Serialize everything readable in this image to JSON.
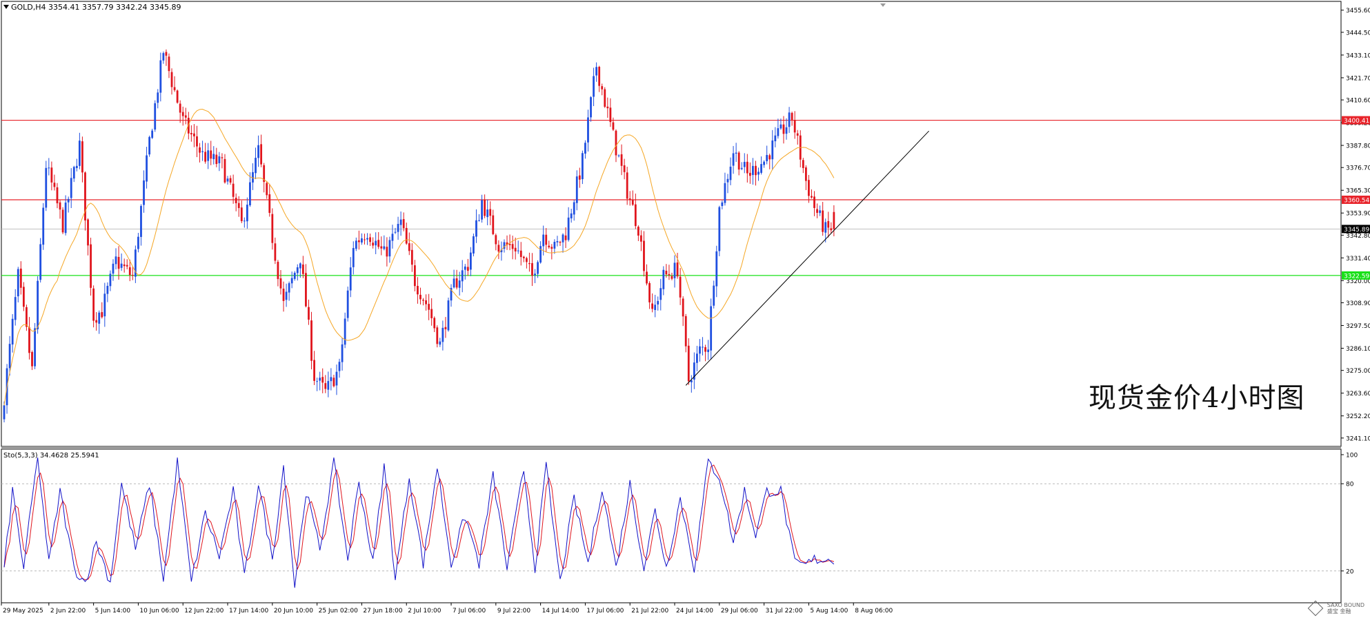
{
  "header": {
    "symbol_line": "GOLD,H4  3354.41 3357.79 3342.24 3345.89"
  },
  "annotation": {
    "text": "现货金价4小时图"
  },
  "watermark": {
    "line1": "SAXO BOUND",
    "line2": "盛宝 金融"
  },
  "colors": {
    "bull": "#1f4fe0",
    "bear": "#e0141c",
    "ma": "#f5a623",
    "resistance": "#e8242b",
    "support": "#19e019",
    "trendline": "#000000",
    "stoch_k": "#1010c8",
    "stoch_d": "#e0141c",
    "grid": "#b8b8b8"
  },
  "chart_data": [
    {
      "type": "candlestick",
      "symbol": "GOLD",
      "timeframe": "H4",
      "last_bar": {
        "open": 3354.41,
        "high": 3357.79,
        "low": 3342.24,
        "close": 3345.89
      },
      "ylim": [
        3236.9,
        3460.0
      ],
      "y_ticks": [
        3455.6,
        3444.5,
        3433.1,
        3421.7,
        3410.6,
        3399.2,
        3387.8,
        3376.7,
        3365.3,
        3353.9,
        3342.8,
        3331.4,
        3320.0,
        3308.9,
        3297.5,
        3286.1,
        3275.0,
        3263.6,
        3252.2,
        3241.1
      ],
      "x_tick_labels": [
        "29 May 2025",
        "2 Jun 22:00",
        "5 Jun 14:00",
        "10 Jun 06:00",
        "12 Jun 22:00",
        "17 Jun 14:00",
        "20 Jun 10:00",
        "25 Jun 02:00",
        "27 Jun 18:00",
        "2 Jul 10:00",
        "7 Jul 06:00",
        "9 Jul 22:00",
        "14 Jul 14:00",
        "17 Jul 06:00",
        "21 Jul 22:00",
        "24 Jul 14:00",
        "29 Jul 06:00",
        "31 Jul 22:00",
        "5 Aug 14:00",
        "8 Aug 06:00"
      ],
      "horizontal_levels": [
        {
          "label": "3400.41",
          "value": 3400.41,
          "kind": "resistance"
        },
        {
          "label": "3360.54",
          "value": 3360.54,
          "kind": "resistance"
        },
        {
          "label": "3345.89",
          "value": 3345.89,
          "kind": "current"
        },
        {
          "label": "3322.59",
          "value": 3322.59,
          "kind": "support"
        }
      ],
      "trendline": {
        "from_bar": 244,
        "from_price": 3267.5,
        "to_bar": 331,
        "to_price": 3395.0
      },
      "price_path": [
        [
          0,
          3250
        ],
        [
          6,
          3322
        ],
        [
          11,
          3275
        ],
        [
          16,
          3378
        ],
        [
          22,
          3348
        ],
        [
          28,
          3388
        ],
        [
          33,
          3302
        ],
        [
          36,
          3305
        ],
        [
          41,
          3330
        ],
        [
          47,
          3322
        ],
        [
          53,
          3390
        ],
        [
          58,
          3435
        ],
        [
          65,
          3400
        ],
        [
          72,
          3383
        ],
        [
          79,
          3378
        ],
        [
          86,
          3348
        ],
        [
          92,
          3385
        ],
        [
          96,
          3350
        ],
        [
          101,
          3308
        ],
        [
          107,
          3332
        ],
        [
          112,
          3272
        ],
        [
          116,
          3264
        ],
        [
          121,
          3276
        ],
        [
          126,
          3338
        ],
        [
          131,
          3345
        ],
        [
          137,
          3333
        ],
        [
          143,
          3349
        ],
        [
          148,
          3320
        ],
        [
          153,
          3306
        ],
        [
          157,
          3288
        ],
        [
          162,
          3318
        ],
        [
          167,
          3328
        ],
        [
          172,
          3360
        ],
        [
          178,
          3338
        ],
        [
          184,
          3337
        ],
        [
          190,
          3322
        ],
        [
          194,
          3344
        ],
        [
          198,
          3336
        ],
        [
          202,
          3344
        ],
        [
          208,
          3380
        ],
        [
          213,
          3428
        ],
        [
          219,
          3392
        ],
        [
          224,
          3365
        ],
        [
          228,
          3347
        ],
        [
          233,
          3302
        ],
        [
          237,
          3322
        ],
        [
          242,
          3326
        ],
        [
          246,
          3270
        ],
        [
          250,
          3285
        ],
        [
          253,
          3288
        ],
        [
          257,
          3356
        ],
        [
          262,
          3385
        ],
        [
          267,
          3373
        ],
        [
          273,
          3380
        ],
        [
          278,
          3392
        ],
        [
          283,
          3402
        ],
        [
          288,
          3370
        ],
        [
          291,
          3357
        ],
        [
          295,
          3345
        ],
        [
          297,
          3346
        ]
      ]
    },
    {
      "type": "line",
      "title": "Sto(5,3,3) 34.4628 25.5941",
      "ylim": [
        0,
        100
      ],
      "y_ticks": [
        100,
        80,
        20
      ],
      "levels": [
        80,
        20
      ],
      "series": [
        {
          "values": []
        },
        {
          "values": []
        }
      ],
      "k_path": [
        [
          0,
          22
        ],
        [
          3,
          75
        ],
        [
          7,
          22
        ],
        [
          12,
          100
        ],
        [
          16,
          25
        ],
        [
          20,
          75
        ],
        [
          25,
          22
        ],
        [
          29,
          12
        ],
        [
          33,
          40
        ],
        [
          38,
          12
        ],
        [
          42,
          80
        ],
        [
          47,
          35
        ],
        [
          52,
          80
        ],
        [
          57,
          15
        ],
        [
          62,
          95
        ],
        [
          67,
          12
        ],
        [
          72,
          60
        ],
        [
          77,
          30
        ],
        [
          82,
          75
        ],
        [
          86,
          15
        ],
        [
          91,
          80
        ],
        [
          96,
          28
        ],
        [
          100,
          92
        ],
        [
          104,
          10
        ],
        [
          108,
          75
        ],
        [
          113,
          35
        ],
        [
          118,
          95
        ],
        [
          123,
          28
        ],
        [
          127,
          82
        ],
        [
          132,
          25
        ],
        [
          136,
          92
        ],
        [
          140,
          15
        ],
        [
          145,
          85
        ],
        [
          150,
          25
        ],
        [
          155,
          92
        ],
        [
          160,
          25
        ],
        [
          165,
          58
        ],
        [
          170,
          25
        ],
        [
          175,
          85
        ],
        [
          180,
          22
        ],
        [
          186,
          90
        ],
        [
          190,
          22
        ],
        [
          194,
          92
        ],
        [
          199,
          12
        ],
        [
          204,
          70
        ],
        [
          209,
          25
        ],
        [
          214,
          78
        ],
        [
          219,
          22
        ],
        [
          224,
          80
        ],
        [
          229,
          22
        ],
        [
          233,
          62
        ],
        [
          237,
          22
        ],
        [
          242,
          70
        ],
        [
          247,
          22
        ],
        [
          252,
          95
        ],
        [
          256,
          85
        ],
        [
          261,
          40
        ],
        [
          265,
          75
        ],
        [
          269,
          45
        ],
        [
          273,
          75
        ],
        [
          278,
          75
        ],
        [
          283,
          25
        ],
        [
          287,
          24
        ],
        [
          290,
          28
        ]
      ]
    }
  ]
}
